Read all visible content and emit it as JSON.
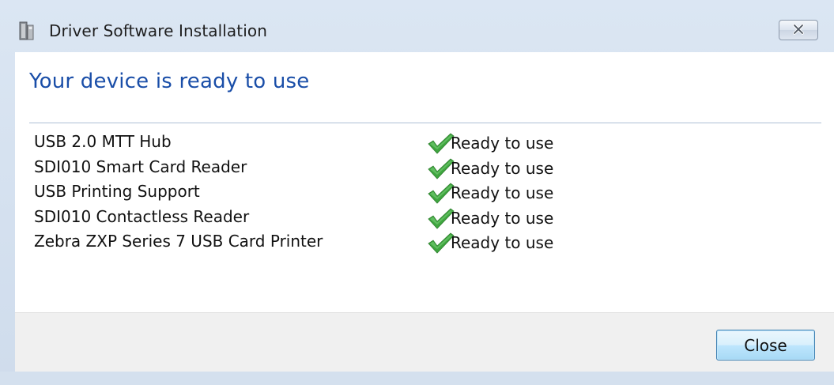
{
  "window": {
    "title": "Driver Software Installation",
    "close_icon": "close-x-icon",
    "app_icon": "device-installer-icon"
  },
  "main": {
    "heading": "Your device is ready to use",
    "devices": [
      {
        "name": "USB 2.0 MTT Hub",
        "status": "Ready to use",
        "status_icon": "green-check-icon"
      },
      {
        "name": "SDI010 Smart Card Reader",
        "status": "Ready to use",
        "status_icon": "green-check-icon"
      },
      {
        "name": "USB Printing Support",
        "status": "Ready to use",
        "status_icon": "green-check-icon"
      },
      {
        "name": "SDI010 Contactless Reader",
        "status": "Ready to use",
        "status_icon": "green-check-icon"
      },
      {
        "name": "Zebra ZXP Series 7 USB Card Printer",
        "status": "Ready to use",
        "status_icon": "green-check-icon"
      }
    ]
  },
  "footer": {
    "close_label": "Close"
  },
  "colors": {
    "heading": "#1a4ea8",
    "check": "#3fa63f",
    "button_border": "#3c7fb1"
  }
}
